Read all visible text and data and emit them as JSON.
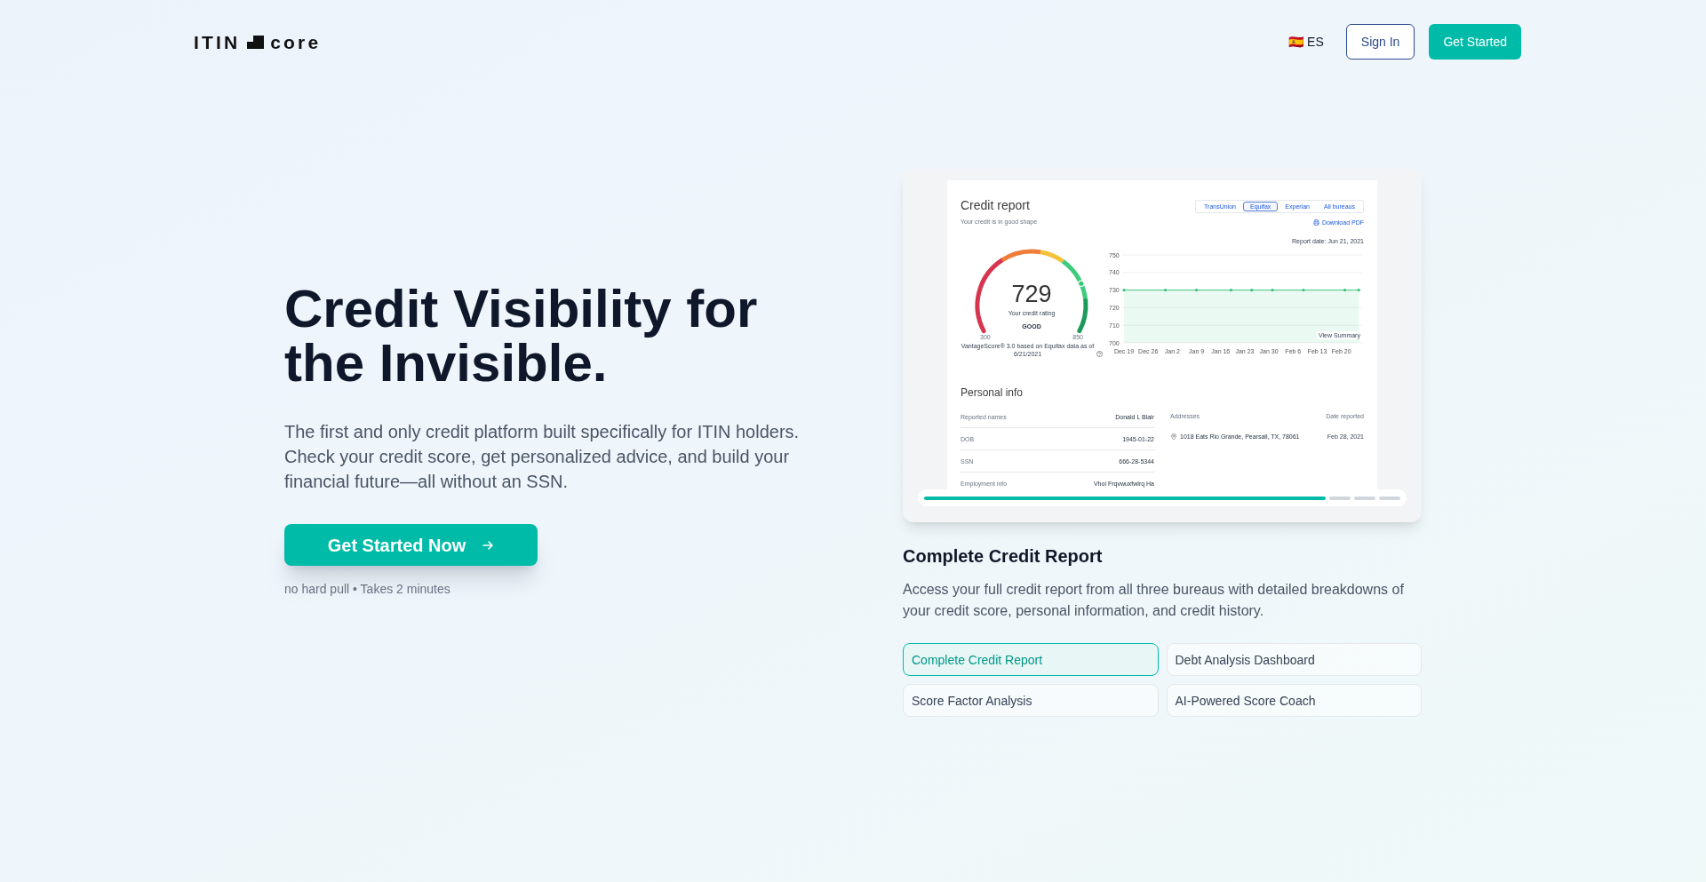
{
  "header": {
    "logo": {
      "prefix": "ITIN",
      "suffix": "core"
    },
    "language": "🇪🇸 ES",
    "buttons": [
      {
        "label": "Sign In",
        "kind": "outline"
      },
      {
        "label": "Get Started",
        "kind": "primary"
      }
    ]
  },
  "hero": {
    "heading": "Credit Visibility for the Invisible.",
    "description": "The first and only credit platform built specifically for ITIN holders. Check your credit score, get personalized advice, and build your financial future—all without an SSN.",
    "cta": "Get Started Now",
    "note": "no hard pull • Takes 2 minutes"
  },
  "showcase": {
    "preview": {
      "title": "Credit report",
      "subtitle": "Your credit is in good shape",
      "bureau_tabs": [
        {
          "label": "TransUnion",
          "selected": false
        },
        {
          "label": "Equifax",
          "selected": true
        },
        {
          "label": "Experian",
          "selected": false
        },
        {
          "label": "All bureaus",
          "selected": false
        }
      ],
      "download": "Download PDF",
      "report_date": "Report date: Jun 21, 2021",
      "score": {
        "value": "729",
        "caption": "Your credit rating",
        "rating": "GOOD",
        "scale_min": "300",
        "scale_max": "850",
        "level": 0.78,
        "source_note": "VantageScore® 3.0 based on Equifax data as of 6/21/2021"
      },
      "chart_data": {
        "type": "area",
        "grid": true,
        "categories": [
          "Dec 19",
          null,
          null,
          null,
          null,
          null,
          null,
          "Dec 26",
          null,
          null,
          null,
          null,
          null,
          null,
          "Jan 2",
          null,
          null,
          null,
          null,
          null,
          null,
          "Jan 9",
          null,
          null,
          null,
          null,
          null,
          null,
          "Jan 16",
          null,
          null,
          null,
          null,
          null,
          null,
          "Jan 23",
          null,
          null,
          null,
          null,
          null,
          null,
          "Jan 30",
          null,
          null,
          null,
          null,
          null,
          null,
          "Feb 6",
          null,
          null,
          null,
          null,
          null,
          null,
          "Feb 13",
          null,
          null,
          null,
          null,
          null,
          null,
          "Feb 20",
          null,
          null,
          null,
          null,
          null,
          null
        ],
        "ylim": [
          700,
          750
        ],
        "yticks": [
          700,
          710,
          720,
          730,
          740,
          750
        ],
        "series": [
          {
            "color": "#34c27a",
            "values": [
              730,
              null,
              null,
              null,
              null,
              null,
              null,
              null,
              null,
              null,
              null,
              null,
              730,
              null,
              null,
              null,
              null,
              null,
              null,
              null,
              null,
              730,
              null,
              null,
              null,
              null,
              null,
              null,
              null,
              null,
              null,
              730,
              null,
              null,
              null,
              null,
              null,
              730,
              null,
              null,
              null,
              null,
              null,
              730,
              null,
              null,
              null,
              null,
              null,
              null,
              null,
              null,
              730,
              null,
              null,
              null,
              null,
              null,
              null,
              null,
              null,
              null,
              null,
              null,
              730,
              null,
              null,
              null,
              730,
              null
            ]
          }
        ]
      },
      "chart_link": "View Summary",
      "personal_info": {
        "title": "Personal info",
        "rows": [
          {
            "label": "Reported names",
            "value": "Donald L Blair"
          },
          {
            "label": "DOB",
            "value": "1945-01-22"
          },
          {
            "label": "SSN",
            "value": "666-28-5344"
          },
          {
            "label": "Employment info",
            "value": "Vhoi Frqvwuxfwlrq Ha"
          }
        ],
        "addresses_heading": "Addresses",
        "date_heading": "Date reported",
        "addresses": [
          {
            "address": "1018 Eats Rio Grande, Pearsall, TX, 78061",
            "date": "Feb 28, 2021"
          }
        ]
      }
    },
    "title": "Complete Credit Report",
    "description": "Access your full credit report from all three bureaus with detailed breakdowns of your credit score, personal information, and credit history.",
    "features": [
      {
        "label": "Complete Credit Report",
        "selected": true
      },
      {
        "label": "Debt Analysis Dashboard",
        "selected": false
      },
      {
        "label": "Score Factor Analysis",
        "selected": false
      },
      {
        "label": "AI-Powered Score Coach",
        "selected": false
      }
    ]
  }
}
